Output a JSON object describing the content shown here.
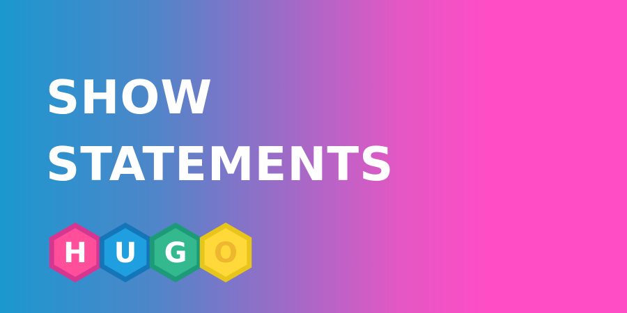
{
  "banner": {
    "title_line1": "SHOW",
    "title_line2": "STATEMENTS"
  },
  "logo": {
    "letters": [
      {
        "char": "H",
        "outer": "#d6368f",
        "inner": "#ff4f9a",
        "text": "#ffffff"
      },
      {
        "char": "U",
        "outer": "#1475b9",
        "inner": "#1f9ee0",
        "text": "#ffffff"
      },
      {
        "char": "G",
        "outer": "#1d9b78",
        "inner": "#34b98f",
        "text": "#ffffff"
      },
      {
        "char": "O",
        "outer": "#e8c51a",
        "inner": "#ffd83a",
        "text": "#efb62f"
      }
    ]
  }
}
